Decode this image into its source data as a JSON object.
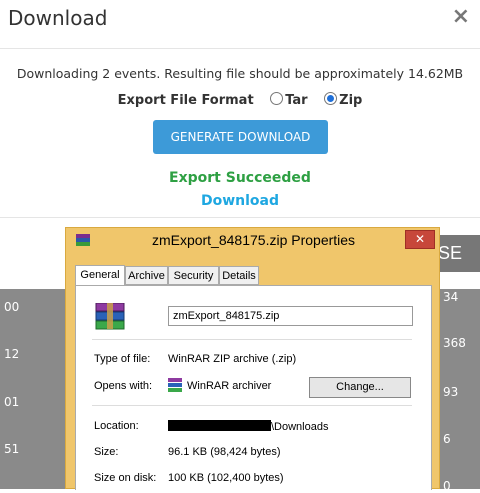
{
  "modal": {
    "title": "Download",
    "close_icon": "close-icon",
    "info": "Downloading 2 events. Resulting file should be approximately 14.62MB",
    "format_label": "Export File Format",
    "format_options": [
      {
        "label": "Tar",
        "checked": false
      },
      {
        "label": "Zip",
        "checked": true
      }
    ],
    "generate_label": "GENERATE DOWNLOAD",
    "status": "Export Succeeded",
    "download_link": "Download",
    "close_button_label": "SE",
    "left_numbers": [
      "00",
      "12",
      "01",
      "51"
    ],
    "right_numbers": [
      "34",
      "368",
      "93",
      "6",
      "0"
    ]
  },
  "properties": {
    "title": "zmExport_848175.zip Properties",
    "tabs": [
      "General",
      "Archive",
      "Security",
      "Details"
    ],
    "active_tab": "General",
    "filename": "zmExport_848175.zip",
    "type_label": "Type of file:",
    "type_value": "WinRAR ZIP archive (.zip)",
    "opens_label": "Opens with:",
    "opens_value": "WinRAR archiver",
    "change_label": "Change...",
    "location_label": "Location:",
    "location_value": "\\Downloads",
    "size_label": "Size:",
    "size_value": "96.1 KB (98,424 bytes)",
    "disk_label": "Size on disk:",
    "disk_value": "100 KB (102,400 bytes)",
    "accent_colors": {
      "title_bar": "#f0c66b",
      "close": "#c7473a",
      "button": "#3d9ad8",
      "success": "#2ea043",
      "link": "#1ea7e1"
    }
  }
}
